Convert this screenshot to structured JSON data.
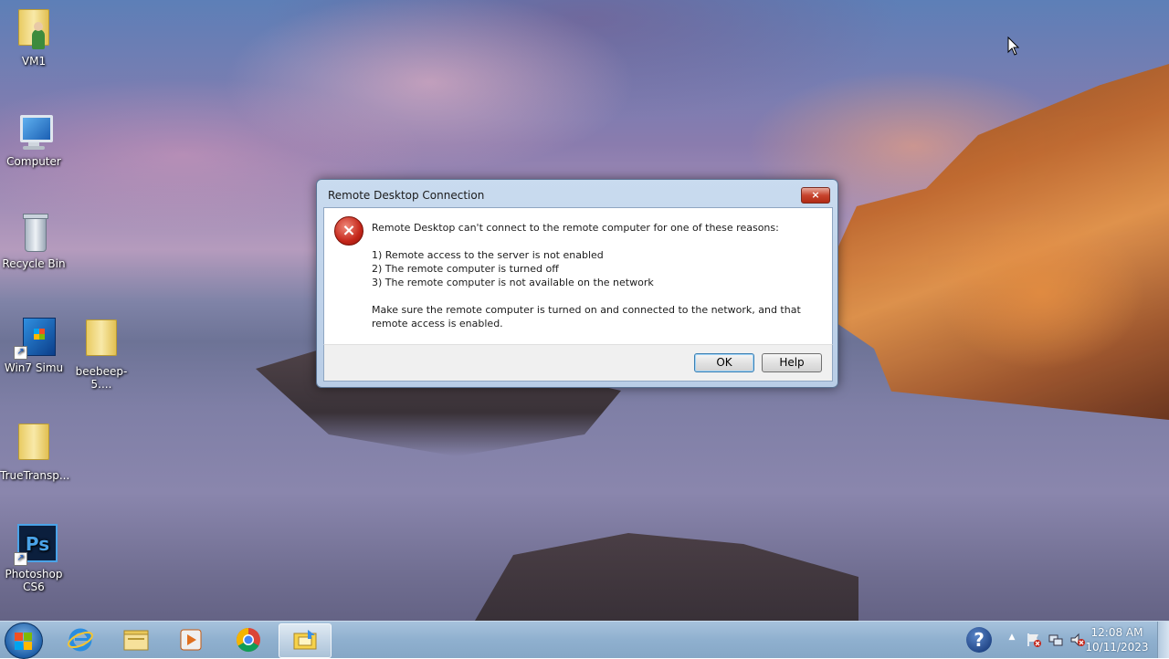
{
  "desktop": {
    "icons": [
      {
        "label": "VM1"
      },
      {
        "label": "Computer"
      },
      {
        "label": "Recycle Bin"
      },
      {
        "label": "Win7 Simu"
      },
      {
        "label": "beebeep-5...."
      },
      {
        "label": "TrueTransp..."
      },
      {
        "label": "Photoshop CS6"
      }
    ]
  },
  "dialog": {
    "title": "Remote Desktop Connection",
    "close_symbol": "×",
    "error_symbol": "×",
    "message_intro": "Remote Desktop can't connect to the remote computer for one of these reasons:",
    "reasons": [
      "1) Remote access to the server is not enabled",
      "2) The remote computer is turned off",
      "3) The remote computer is not available on the network"
    ],
    "advice": "Make sure the remote computer is turned on and connected to the network, and that remote access is enabled.",
    "ok_label": "OK",
    "help_label": "Help"
  },
  "taskbar": {
    "buttons": [
      {
        "icon": "internet-explorer-icon"
      },
      {
        "icon": "file-explorer-icon"
      },
      {
        "icon": "media-player-icon"
      },
      {
        "icon": "chrome-icon"
      },
      {
        "icon": "remote-desktop-icon",
        "active": true
      }
    ],
    "tray": {
      "help_symbol": "?",
      "chevron": "▲"
    },
    "clock": {
      "time": "12:08 AM",
      "date": "10/11/2023"
    }
  },
  "colors": {
    "taskbar": "#8fb0cf",
    "dialog_frame": "#c9dbef",
    "error_red": "#c4261a"
  }
}
